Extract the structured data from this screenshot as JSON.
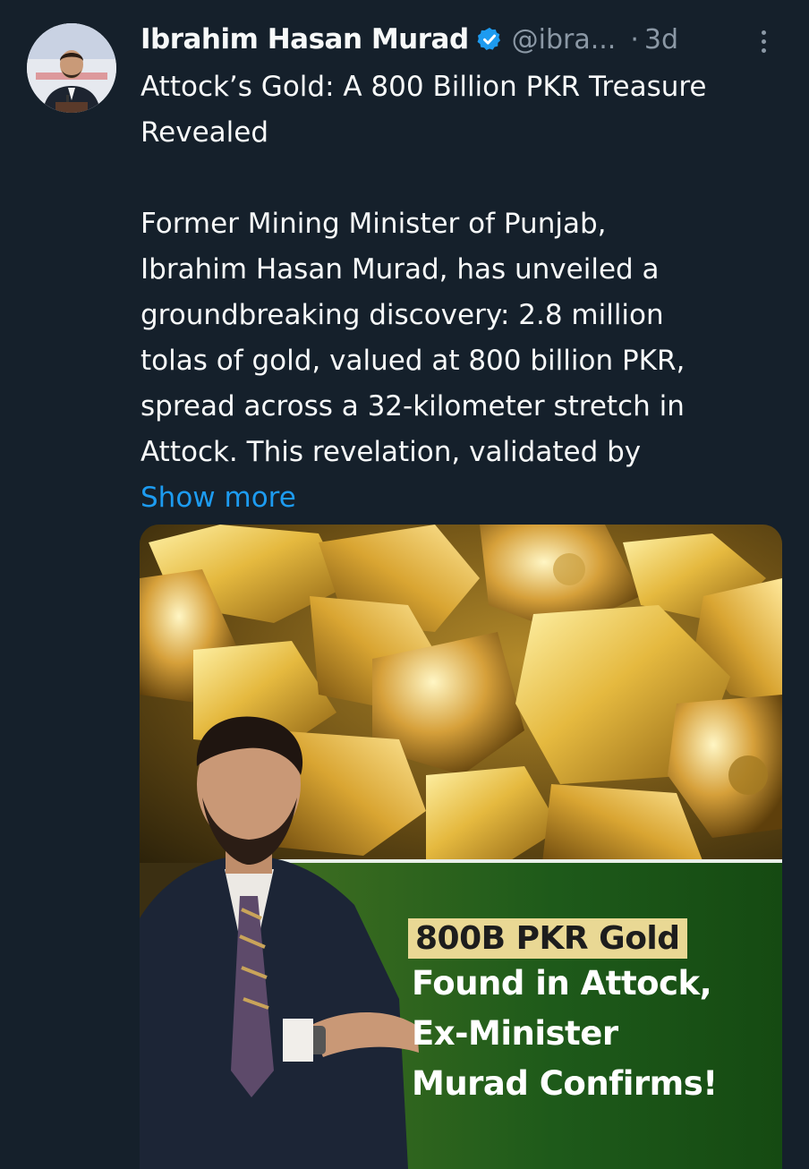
{
  "tweet": {
    "author_name": "Ibrahim Hasan Murad",
    "handle": "@ibra...",
    "separator": "·",
    "time": "3d",
    "lines": [
      "Attock’s Gold: A 800 Billion PKR Treasure",
      "Revealed",
      "",
      "Former Mining Minister of Punjab,",
      "Ibrahim Hasan Murad, has unveiled a",
      "groundbreaking discovery: 2.8 million",
      "tolas of gold, valued at 800 billion PKR,",
      "spread across a 32-kilometer stretch in",
      "Attock. This revelation, validated by"
    ],
    "show_more": "Show more",
    "icons": {
      "verified": "verified-badge-icon",
      "more": "more-options-icon"
    }
  },
  "media": {
    "headline_highlight": "800B PKR Gold",
    "headline_lines": [
      "Found in Attock,",
      "Ex-Minister",
      "Murad Confirms!"
    ]
  },
  "colors": {
    "background": "#15202b",
    "text": "#f7f9f9",
    "muted": "#8b98a5",
    "link": "#1d9bf0",
    "highlight": "#e9d894",
    "band": "#1e5a1a"
  }
}
